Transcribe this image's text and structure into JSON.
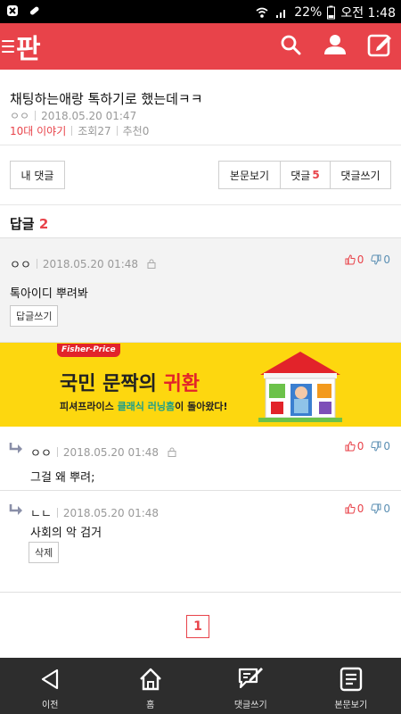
{
  "status_bar": {
    "battery": "22%",
    "time": "오전 1:48"
  },
  "header": {
    "logo": "판"
  },
  "post": {
    "title": "채팅하는애랑 톡하기로 했는데ㅋㅋ",
    "author": "ㅇㅇ",
    "datetime": "2018.05.20 01:47",
    "category": "10대 이야기",
    "views": "조회27",
    "recommends": "추천0"
  },
  "buttons": {
    "my_comments": "내 댓글",
    "view_post": "본문보기",
    "comments_label": "댓글",
    "comments_count": "5",
    "write_comment": "댓글쓰기"
  },
  "replies_section": {
    "label": "답글",
    "count": "2"
  },
  "main_comment": {
    "author": "ㅇㅇ",
    "datetime": "2018.05.20 01:48",
    "likes": "0",
    "dislikes": "0",
    "text": "톡아이디 뿌려봐",
    "reply_button": "답글쓰기"
  },
  "ad": {
    "brand": "Fisher-Price",
    "headline_prefix": "국민 문짝의 ",
    "headline_highlight": "귀환",
    "sub_prefix": "피셔프라이스 ",
    "sub_highlight": "클래식 러닝홈",
    "sub_suffix": "이 돌아왔다!"
  },
  "replies": [
    {
      "author": "ㅇㅇ",
      "datetime": "2018.05.20 01:48",
      "likes": "0",
      "dislikes": "0",
      "text": "그걸 왜 뿌려;"
    },
    {
      "author": "ㄴㄴ",
      "datetime": "2018.05.20 01:48",
      "likes": "0",
      "dislikes": "0",
      "text": "사회의 악 검거",
      "delete_button": "삭제"
    }
  ],
  "pagination": {
    "current_page": "1"
  },
  "bottom_nav": {
    "items": [
      {
        "label": "이전",
        "icon": "back-icon"
      },
      {
        "label": "홈",
        "icon": "home-icon"
      },
      {
        "label": "댓글쓰기",
        "icon": "write-comment-icon"
      },
      {
        "label": "본문보기",
        "icon": "document-icon"
      }
    ]
  },
  "colors": {
    "brand_red": "#e8434a",
    "ad_yellow": "#fdd70f",
    "nav_dark": "#2d2d2d",
    "dislike_blue": "#5b8fb3"
  }
}
